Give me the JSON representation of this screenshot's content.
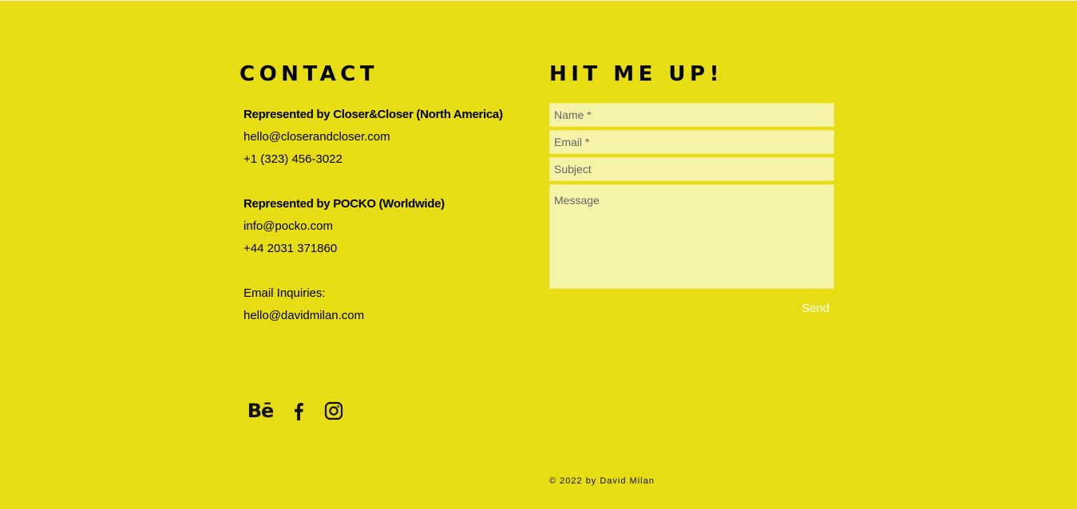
{
  "contact": {
    "heading": "CONTACT",
    "rep1": {
      "title": "Represented by Closer&Closer (North America)",
      "email": "hello@closerandcloser.com",
      "phone": "+1 (323) 456-3022"
    },
    "rep2": {
      "title": "Represented by POCKO (Worldwide)",
      "email": "info@pocko.com",
      "phone": "+44 2031 371860"
    },
    "inquiries": {
      "label": "Email Inquiries:",
      "email": "hello@davidmilan.com"
    }
  },
  "form": {
    "heading": "HIT ME UP!",
    "name_placeholder": "Name *",
    "email_placeholder": "Email *",
    "subject_placeholder": "Subject",
    "message_placeholder": "Message",
    "send_label": "Send"
  },
  "social": {
    "behance_label": "Bē",
    "icons": [
      "behance-icon",
      "facebook-icon",
      "instagram-icon"
    ]
  },
  "footer": {
    "text": "© 2022 by David Milan"
  },
  "colors": {
    "background": "#e8dc12",
    "field_background": "#f6f2a8",
    "send_text": "#ffffff"
  }
}
